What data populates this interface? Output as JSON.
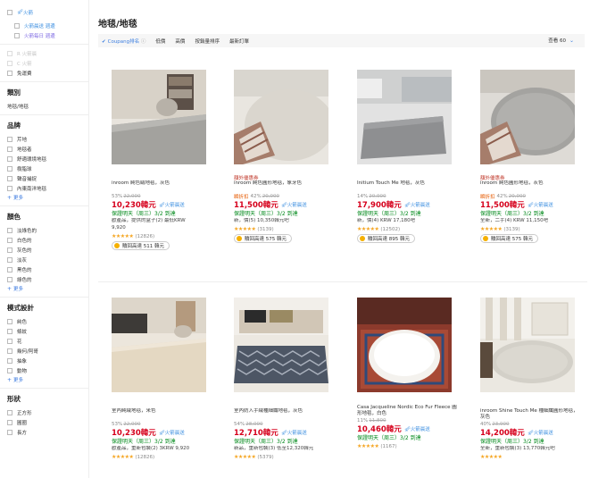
{
  "sidebar": {
    "top_rocket_label": "火箭",
    "delivery_options": [
      {
        "label": "火箭晨送 週邊",
        "color": "blue"
      },
      {
        "label": "火箭每日 週邊",
        "color": "violet"
      }
    ],
    "faint_options": [
      {
        "label": "R 火箭晨"
      },
      {
        "label": "C 火箭"
      }
    ],
    "free_shipping": "免運費",
    "category": {
      "title": "類別",
      "item": "地毯/地毯"
    },
    "brand": {
      "title": "品牌",
      "items": [
        "芹地",
        "地毯者",
        "舒適環境地毯",
        "樹脂球",
        "聲音捕捉",
        "內東南洋地毯"
      ],
      "more": "更多"
    },
    "color": {
      "title": "顏色",
      "items": [
        "淡綠色的",
        "白色的",
        "灰色的",
        "淡灰",
        "黑色的",
        "綠色的"
      ],
      "more": "更多"
    },
    "pattern": {
      "title": "模式設計",
      "items": [
        "純色",
        "條紋",
        "花",
        "幾何/阿哥",
        "抽象",
        "動物"
      ],
      "more": "更多"
    },
    "shape": {
      "title": "形狀",
      "items": [
        "正方形",
        "圓圈",
        "長方"
      ]
    }
  },
  "main": {
    "title": "地毯/地毯",
    "sort": {
      "coupang": "Coupang排名",
      "info_icon": "ⓘ",
      "items": [
        "低價",
        "高價",
        "按銷量排序",
        "最新訂單"
      ]
    },
    "per_page": "查看 60"
  },
  "products": [
    {
      "badge": "",
      "name": "inroom 純色絨地毯，灰色",
      "discount_pct": "53%",
      "orig_price": "22,000",
      "sale_label": "",
      "price": "10,230韓元",
      "rocket_tag": "火箭晨送",
      "delivery": "保證明天（周三）3/2 到達",
      "unit": "歡產品，提供的盒子(2) 最低KRW",
      "unit2": "9,920",
      "stars": "★★★★★",
      "reviews": "(12826)",
      "cashback": "贖回高達 511 韓元"
    },
    {
      "badge": "額外優惠券",
      "name": "inroom 純色圓形地毯，象牙色",
      "discount_pct": "42%",
      "orig_price": "20,000",
      "sale_label": "瞬折扣",
      "price": "11,500韓元",
      "rocket_tag": "火箭晨送",
      "delivery": "保證明天（周三）3/2 到達",
      "unit": "新，價(5) 10,350韓元吧",
      "unit2": "",
      "stars": "★★★★★",
      "reviews": "(3139)",
      "cashback": "贖回高達 575 韓元"
    },
    {
      "badge": "",
      "name": "Initium Touch Me 地毯，灰色",
      "discount_pct": "14%",
      "orig_price": "20,900",
      "sale_label": "",
      "price": "17,900韓元",
      "rocket_tag": "火箭晨送",
      "delivery": "保證明天（周三）3/2 到達",
      "unit": "新，價(4) KRW 17,180吧",
      "unit2": "",
      "stars": "★★★★★",
      "reviews": "(12502)",
      "cashback": "贖回高達 895 韓元"
    },
    {
      "badge": "額外優惠券",
      "name": "inroom 純色圓形地毯，灰色",
      "discount_pct": "42%",
      "orig_price": "20,000",
      "sale_label": "瞬折扣",
      "price": "11,500韓元",
      "rocket_tag": "火箭晨送",
      "delivery": "保證明天（周三）3/2 到達",
      "unit": "全新，二手(4) KRW 11,150吧",
      "unit2": "",
      "stars": "★★★★★",
      "reviews": "(3139)",
      "cashback": "贖回高達 575 韓元"
    },
    {
      "badge": "",
      "name": "室內純絨地毯，米色",
      "discount_pct": "53%",
      "orig_price": "22,000",
      "sale_label": "",
      "price": "10,230韓元",
      "rocket_tag": "火箭晨送",
      "delivery": "保證明天（周三）3/2 到達",
      "unit": "歡產品，重新包裝(2) 3KRW 9,920",
      "unit2": "",
      "stars": "★★★★★",
      "reviews": "(12826)",
      "cashback": ""
    },
    {
      "badge": "",
      "name": "室內防入手絨種細纖地毯，灰色",
      "discount_pct": "54%",
      "orig_price": "28,000",
      "sale_label": "",
      "price": "12,710韓元",
      "rocket_tag": "火箭晨送",
      "delivery": "保證明天（周三）3/2 到達",
      "unit": "新品，重新包裝(3) 低至12,320韓元",
      "unit2": "",
      "stars": "★★★★★",
      "reviews": "(5379)",
      "cashback": ""
    },
    {
      "badge": "",
      "name": "Casa Jacqueline Nordic Eco Fur Fleece 圓形地毯，白色",
      "discount_pct": "11%",
      "orig_price": "11,800",
      "sale_label": "",
      "price": "10,460韓元",
      "rocket_tag": "火箭晨送",
      "delivery": "保證明天（周三）3/2 到達",
      "unit": "",
      "unit2": "",
      "stars": "★★★★★",
      "reviews": "(1167)",
      "cashback": ""
    },
    {
      "badge": "",
      "name": "inroom Shine Touch Me 種細纖圓形地毯，灰色",
      "discount_pct": "40%",
      "orig_price": "23,900",
      "sale_label": "",
      "price": "14,200韓元",
      "rocket_tag": "火箭晨送",
      "delivery": "保證明天（周三）3/2 到達",
      "unit": "全新，重新包裝(3) 13,770韓元吧",
      "unit2": "",
      "stars": "★★★★★",
      "reviews": "",
      "cashback": ""
    }
  ]
}
